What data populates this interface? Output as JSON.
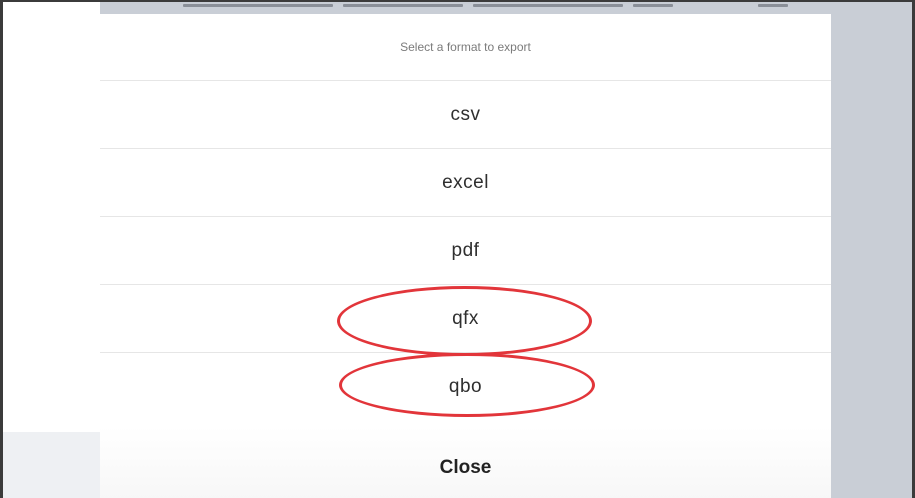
{
  "dialog": {
    "title": "Select a format to export",
    "options": [
      {
        "label": "csv"
      },
      {
        "label": "excel"
      },
      {
        "label": "pdf"
      },
      {
        "label": "qfx",
        "highlighted": true
      },
      {
        "label": "qbo",
        "highlighted": true
      }
    ],
    "close_label": "Close"
  },
  "colors": {
    "overlay": "#c9ced6",
    "annotation": "#e2353a",
    "divider": "#e6e6e6"
  }
}
